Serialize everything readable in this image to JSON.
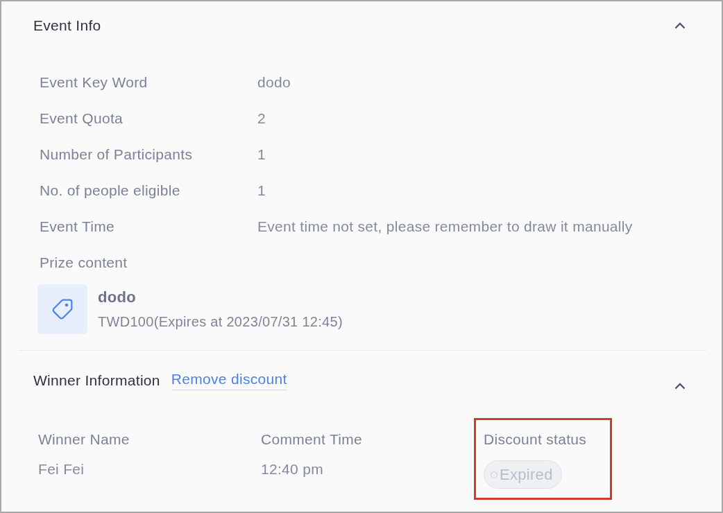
{
  "event_info": {
    "title": "Event Info",
    "expanded": true,
    "fields": [
      {
        "label": "Event Key Word",
        "value": "dodo"
      },
      {
        "label": "Event Quota",
        "value": "2"
      },
      {
        "label": "Number of Participants",
        "value": "1"
      },
      {
        "label": "No. of people eligible",
        "value": "1"
      },
      {
        "label": "Event Time",
        "value": "Event time not set, please remember to draw it manually"
      }
    ],
    "prize": {
      "label": "Prize content",
      "name": "dodo",
      "detail": "TWD100(Expires at 2023/07/31 12:45)"
    }
  },
  "winner_info": {
    "title": "Winner Information",
    "action": "Remove discount",
    "expanded": true,
    "columns": [
      {
        "header": "Winner Name",
        "kind": "text",
        "value": "Fei Fei",
        "highlighted": false
      },
      {
        "header": "Comment Time",
        "kind": "text",
        "value": "12:40 pm",
        "highlighted": false
      },
      {
        "header": "Discount status",
        "kind": "badge",
        "value": "Expired",
        "highlighted": true
      }
    ]
  }
}
